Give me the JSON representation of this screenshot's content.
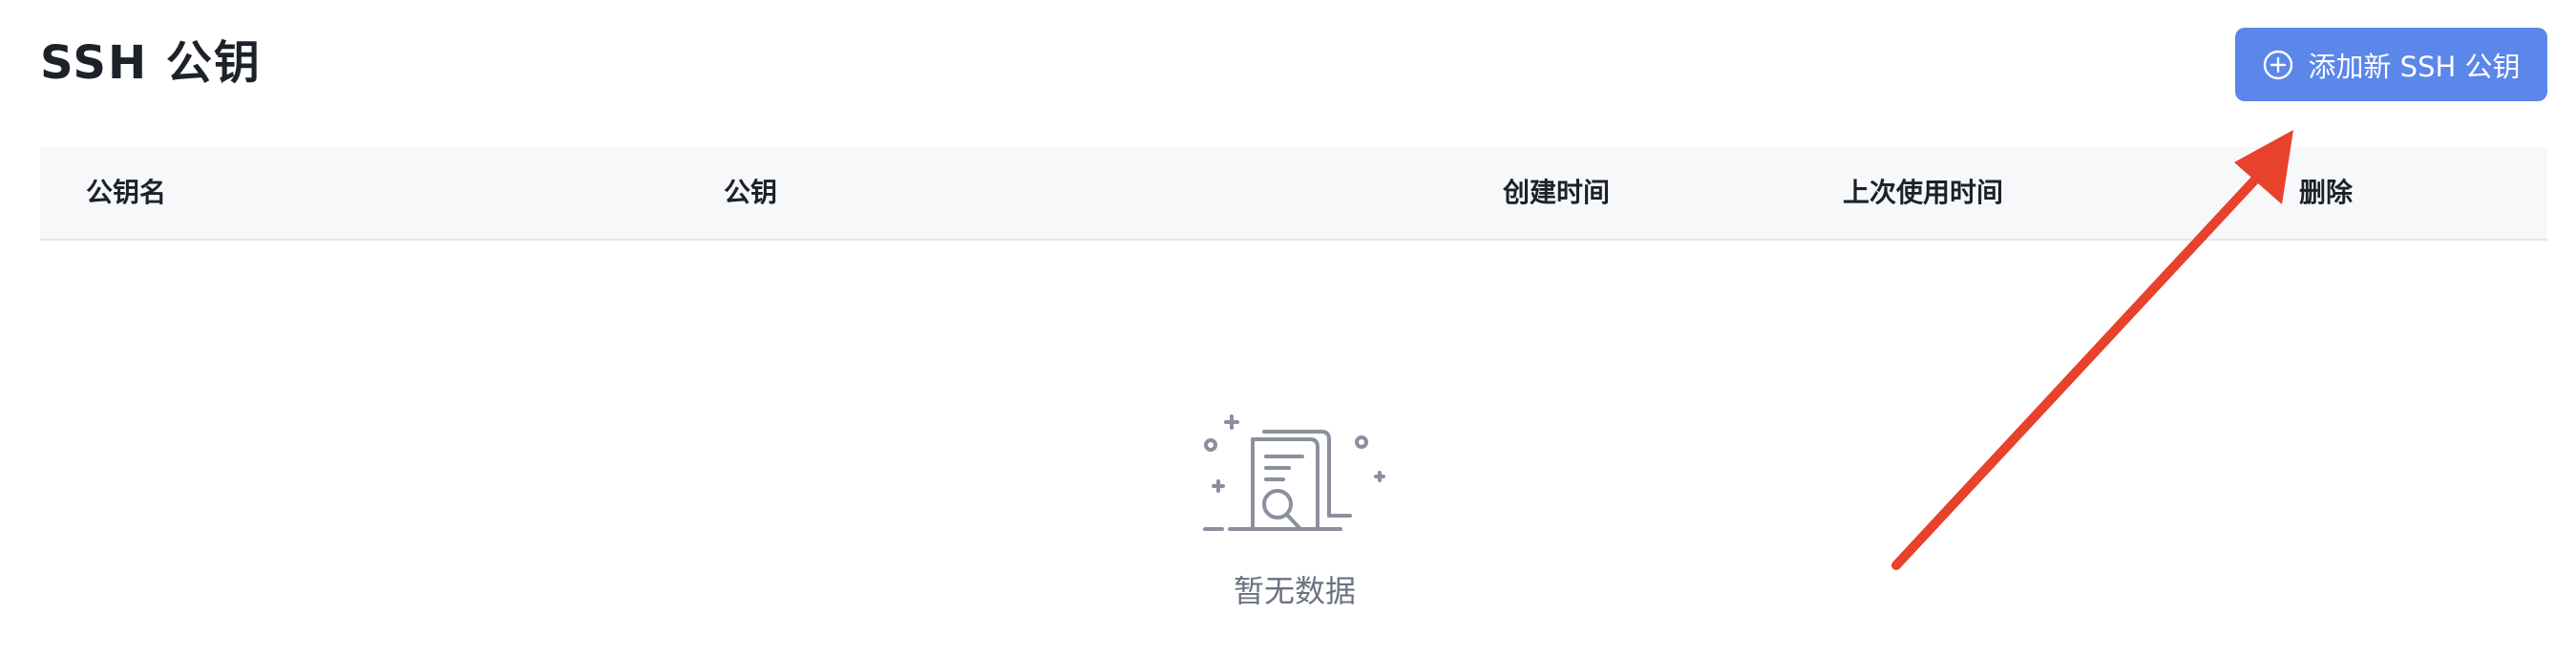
{
  "page": {
    "title": "SSH  公钥"
  },
  "toolbar": {
    "add_label": "添加新 SSH 公钥"
  },
  "table": {
    "columns": [
      "公钥名",
      "公钥",
      "创建时间",
      "上次使用时间",
      "删除"
    ],
    "rows": []
  },
  "empty": {
    "text": "暂无数据"
  },
  "colors": {
    "primary": "#5b86ea",
    "annotation_arrow": "#e8412c",
    "header_bg": "#f7f8fa"
  },
  "icons": {
    "add": "plus-circle-icon",
    "empty": "empty-document-icon"
  }
}
